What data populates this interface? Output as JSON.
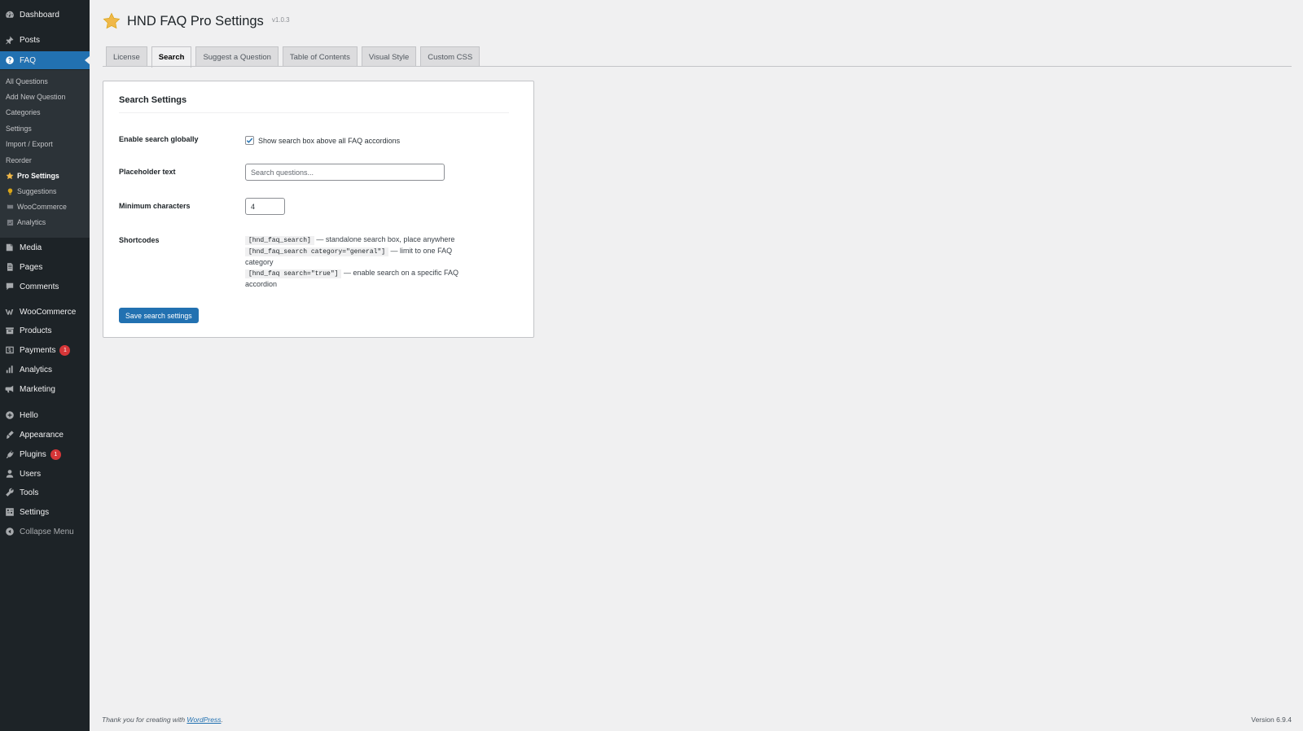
{
  "sidebar": {
    "top_items": [
      {
        "label": "Dashboard",
        "icon": "dashboard-icon"
      },
      {
        "label": "Posts",
        "icon": "pin-icon"
      },
      {
        "label": "FAQ",
        "icon": "question-circle-icon"
      }
    ],
    "faq_submenu": [
      {
        "label": "All Questions"
      },
      {
        "label": "Add New Question"
      },
      {
        "label": "Categories"
      },
      {
        "label": "Settings"
      },
      {
        "label": "Import / Export"
      },
      {
        "label": "Reorder"
      },
      {
        "label": "Pro Settings",
        "icon": "star-icon"
      },
      {
        "label": "Suggestions",
        "icon": "lightbulb-icon"
      },
      {
        "label": "WooCommerce",
        "icon": "cart-icon"
      },
      {
        "label": "Analytics",
        "icon": "chart-icon"
      }
    ],
    "bottom_items": [
      {
        "label": "Media",
        "icon": "media-icon"
      },
      {
        "label": "Pages",
        "icon": "pages-icon"
      },
      {
        "label": "Comments",
        "icon": "comment-icon"
      },
      {
        "label": "WooCommerce",
        "icon": "woocommerce-icon"
      },
      {
        "label": "Products",
        "icon": "archive-icon"
      },
      {
        "label": "Payments",
        "icon": "dollar-icon",
        "badge": "1"
      },
      {
        "label": "Analytics",
        "icon": "bar-chart-icon"
      },
      {
        "label": "Marketing",
        "icon": "megaphone-icon"
      },
      {
        "label": "Hello",
        "icon": "plus-circle-icon"
      },
      {
        "label": "Appearance",
        "icon": "brush-icon"
      },
      {
        "label": "Plugins",
        "icon": "plug-icon",
        "badge": "1"
      },
      {
        "label": "Users",
        "icon": "user-icon"
      },
      {
        "label": "Tools",
        "icon": "wrench-icon"
      },
      {
        "label": "Settings",
        "icon": "sliders-icon"
      },
      {
        "label": "Collapse Menu",
        "icon": "collapse-icon"
      }
    ]
  },
  "header": {
    "title": "HND FAQ Pro Settings",
    "version": "v1.0.3",
    "icon": "star-icon"
  },
  "tabs": [
    {
      "label": "License",
      "active": false
    },
    {
      "label": "Search",
      "active": true
    },
    {
      "label": "Suggest a Question",
      "active": false
    },
    {
      "label": "Table of Contents",
      "active": false
    },
    {
      "label": "Visual Style",
      "active": false
    },
    {
      "label": "Custom CSS",
      "active": false
    }
  ],
  "card": {
    "title": "Search Settings",
    "enable_label": "Enable search globally",
    "enable_checkbox_label": "Show search box above all FAQ accordions",
    "enable_checked": true,
    "placeholder_label": "Placeholder text",
    "placeholder_hint": "Search questions...",
    "min_chars_label": "Minimum characters",
    "min_chars_value": "4",
    "shortcodes_label": "Shortcodes",
    "shortcodes": [
      {
        "code": "[hnd_faq_search]",
        "desc": "— standalone search box, place anywhere"
      },
      {
        "code": "[hnd_faq_search category=\"general\"]",
        "desc": "— limit to one FAQ category"
      },
      {
        "code": "[hnd_faq search=\"true\"]",
        "desc": "— enable search on a specific FAQ accordion"
      }
    ],
    "save_label": "Save search settings"
  },
  "footer": {
    "thanks_prefix": "Thank you for creating with ",
    "thanks_link": "WordPress",
    "thanks_suffix": ".",
    "version": "Version 6.9.4"
  },
  "colors": {
    "sidebar_bg": "#1d2327",
    "submenu_bg": "#2c3338",
    "accent": "#2271b1",
    "badge": "#d63638",
    "star": "#f0b849"
  }
}
